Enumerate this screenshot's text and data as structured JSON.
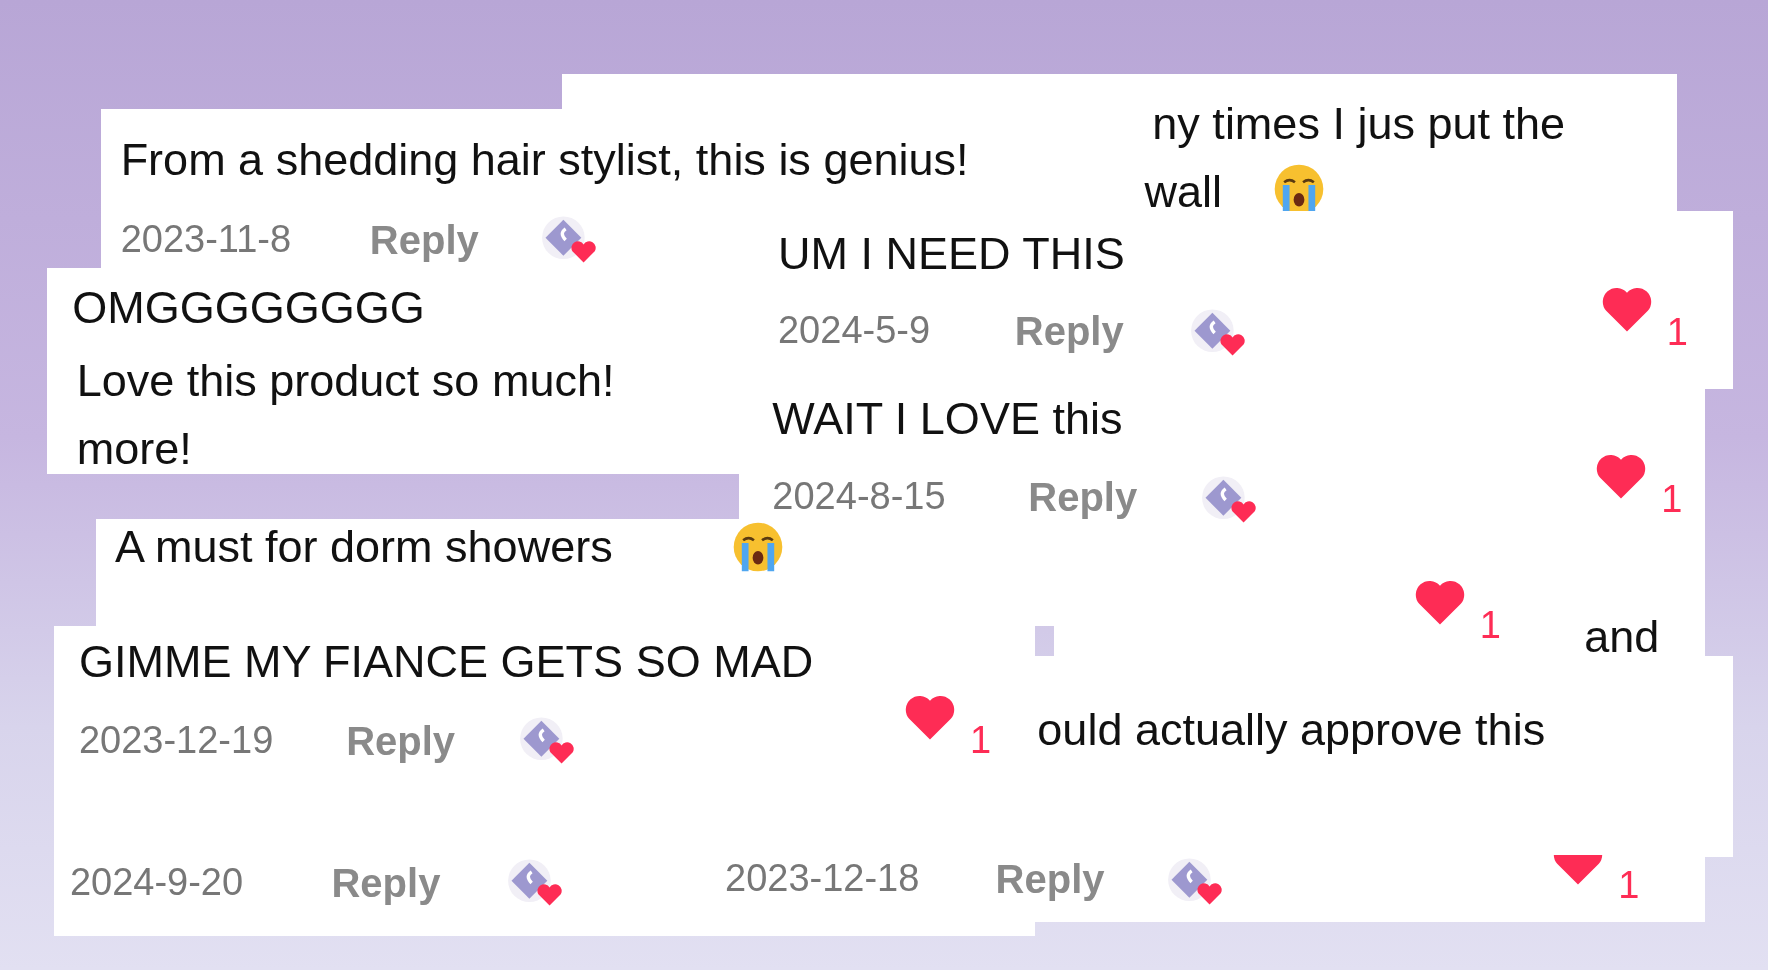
{
  "cards": [
    {
      "elements": [
        {
          "kind": "text",
          "text": "ny times I jus put the"
        },
        {
          "kind": "text",
          "text": "wall"
        },
        {
          "kind": "crying-emoji"
        }
      ]
    },
    {
      "elements": [
        {
          "kind": "text",
          "text": "From a shedding hair stylist, this is genius!"
        },
        {
          "kind": "date",
          "text": "2023-11-8"
        },
        {
          "kind": "reply",
          "text": "Reply"
        },
        {
          "kind": "creator-badge"
        }
      ]
    },
    {
      "elements": [
        {
          "kind": "text",
          "text": "OMGGGGGGGG"
        },
        {
          "kind": "text",
          "text": "Love this product so much!"
        },
        {
          "kind": "text",
          "text": "more!"
        }
      ]
    },
    {
      "elements": [
        {
          "kind": "text",
          "text": "UM I NEED THIS"
        },
        {
          "kind": "date",
          "text": "2024-5-9"
        },
        {
          "kind": "reply",
          "text": "Reply"
        },
        {
          "kind": "creator-badge"
        },
        {
          "kind": "like",
          "count": "1"
        }
      ]
    },
    {
      "elements": [
        {
          "kind": "text",
          "text": "WAIT I LOVE this"
        },
        {
          "kind": "date",
          "text": "2024-8-15"
        },
        {
          "kind": "reply",
          "text": "Reply"
        },
        {
          "kind": "creator-badge"
        },
        {
          "kind": "like",
          "count": "1"
        }
      ]
    },
    {
      "elements": [
        {
          "kind": "text",
          "text": "A must for dorm showers"
        },
        {
          "kind": "crying-emoji"
        }
      ]
    },
    {
      "elements": [
        {
          "kind": "like",
          "count": "1"
        },
        {
          "kind": "text",
          "text": "and"
        }
      ]
    },
    {
      "elements": [
        {
          "kind": "text",
          "text": "GIMME MY FIANCE GETS SO MAD"
        },
        {
          "kind": "date",
          "text": "2023-12-19"
        },
        {
          "kind": "reply",
          "text": "Reply"
        },
        {
          "kind": "creator-badge"
        },
        {
          "kind": "like",
          "count": "1"
        },
        {
          "kind": "date",
          "text": "2024-9-20"
        },
        {
          "kind": "reply",
          "text": "Reply"
        },
        {
          "kind": "creator-badge"
        }
      ]
    },
    {
      "elements": [
        {
          "kind": "text",
          "text": "ould actually approve this"
        }
      ]
    },
    {
      "elements": [
        {
          "kind": "date",
          "text": "2023-12-18"
        },
        {
          "kind": "reply",
          "text": "Reply"
        },
        {
          "kind": "creator-badge"
        },
        {
          "kind": "like",
          "count": "1"
        }
      ]
    }
  ]
}
